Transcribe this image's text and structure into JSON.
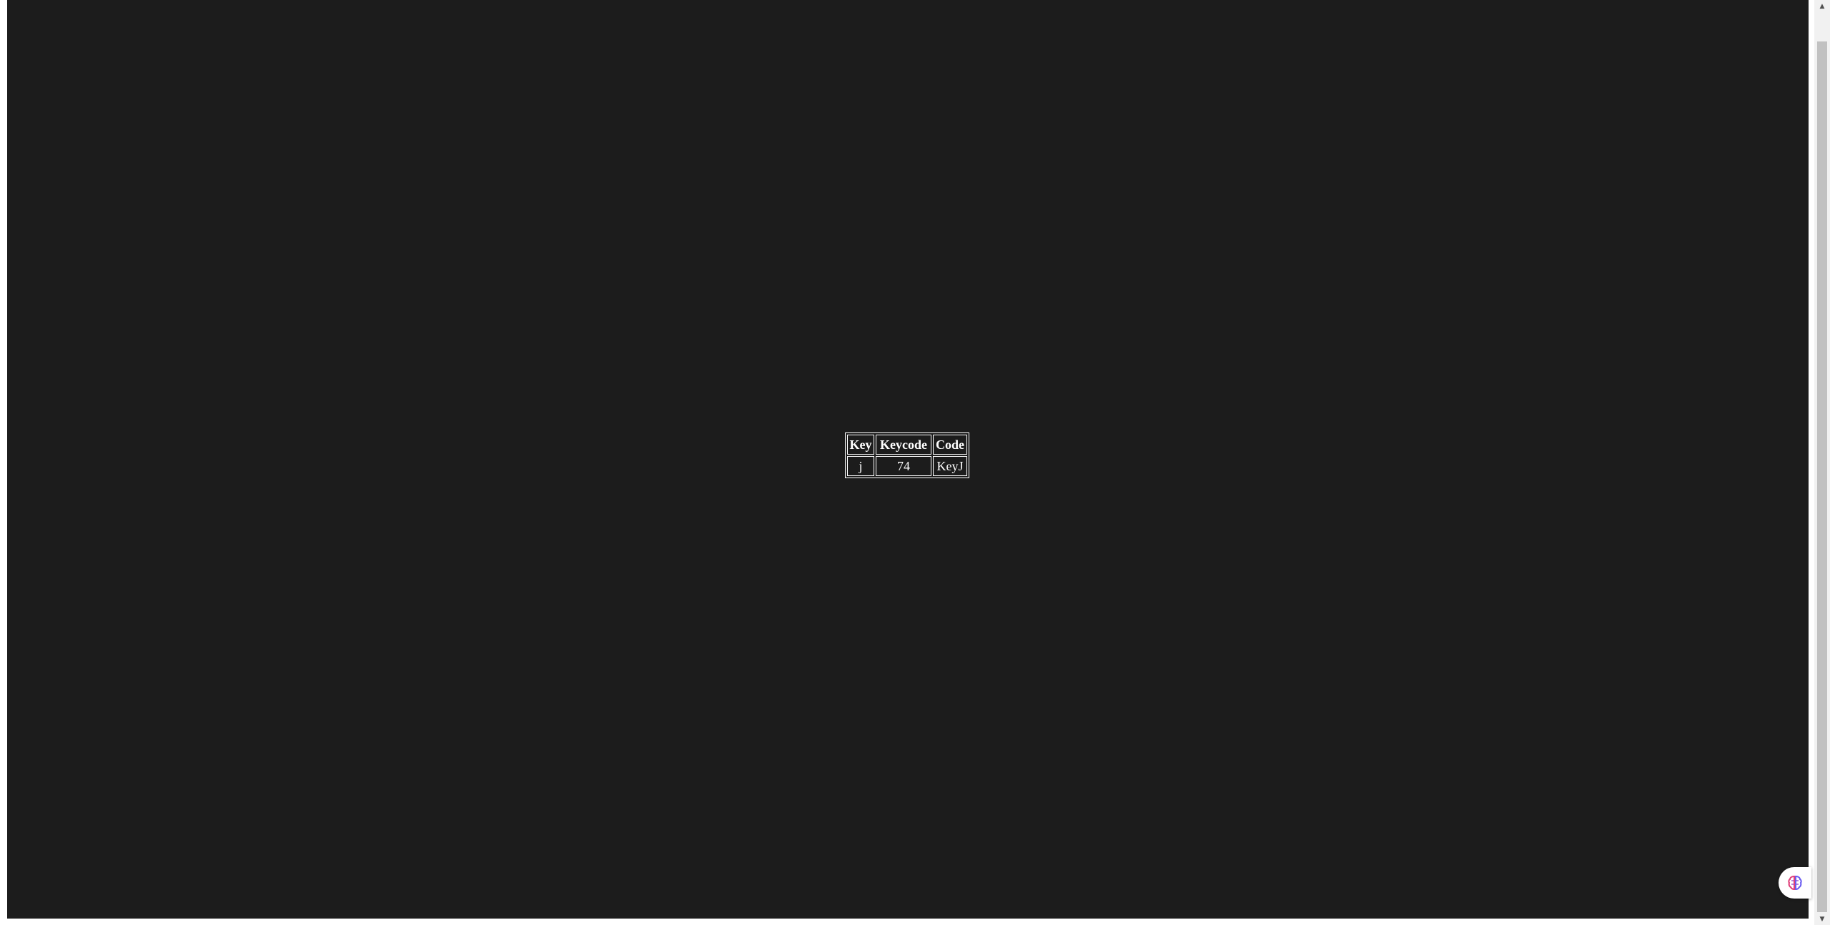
{
  "table": {
    "headers": [
      "Key",
      "Keycode",
      "Code"
    ],
    "rows": [
      [
        "j",
        "74",
        "KeyJ"
      ]
    ]
  },
  "scrollbar": {
    "up_icon": "triangle-up",
    "down_icon": "triangle-down"
  },
  "widget": {
    "icon": "brain-icon",
    "colors": {
      "left_lobe": "#e0407a",
      "right_lobe": "#6a5cf0"
    }
  },
  "theme": {
    "background": "#1c1c1c",
    "text": "#ffffff"
  }
}
